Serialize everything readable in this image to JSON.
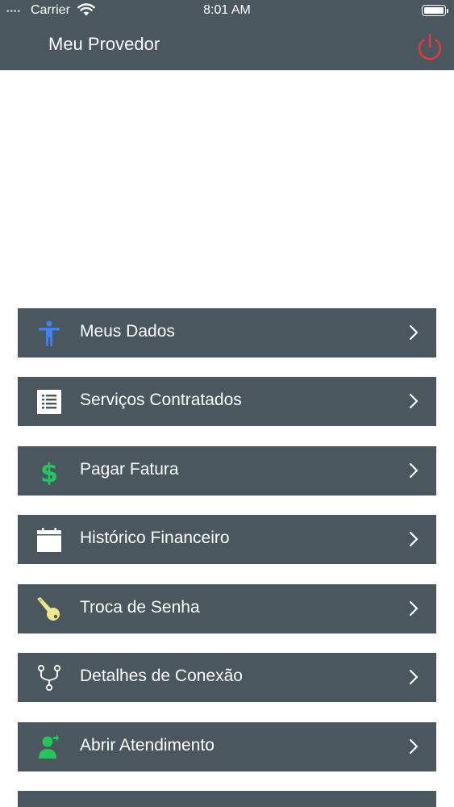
{
  "status_bar": {
    "signal": "••••",
    "carrier": "Carrier",
    "time": "8:01 AM"
  },
  "header": {
    "title": "Meu Provedor",
    "power_icon": "power-icon",
    "power_color": "#e53935"
  },
  "colors": {
    "bar_background": "#4a575e",
    "text": "#ffffff"
  },
  "menu": {
    "items": [
      {
        "label": "Meus Dados",
        "icon": "person-icon",
        "icon_color": "#3b82f6"
      },
      {
        "label": "Serviços Contratados",
        "icon": "list-icon",
        "icon_color": "#ffffff"
      },
      {
        "label": "Pagar Fatura",
        "icon": "dollar-icon",
        "icon_color": "#22c55e"
      },
      {
        "label": "Histórico Financeiro",
        "icon": "calendar-icon",
        "icon_color": "#ffffff"
      },
      {
        "label": "Troca de Senha",
        "icon": "key-icon",
        "icon_color": "#f0e68c"
      },
      {
        "label": "Detalhes de Conexão",
        "icon": "network-icon",
        "icon_color": "#ffffff"
      },
      {
        "label": "Abrir Atendimento",
        "icon": "support-user-icon",
        "icon_color": "#22c55e"
      }
    ]
  }
}
